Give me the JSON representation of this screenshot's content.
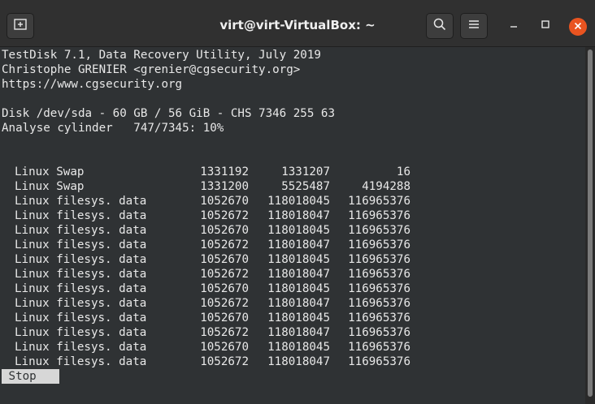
{
  "window": {
    "title": "virt@virt-VirtualBox: ~",
    "icons": {
      "new_tab": "new-tab-icon",
      "search": "search-icon",
      "menu": "hamburger-menu-icon",
      "minimize": "minimize-icon",
      "maximize": "maximize-icon",
      "close": "close-icon"
    },
    "colors": {
      "close_accent": "#e95420",
      "terminal_bg": "#2f3234",
      "terminal_fg": "#e8e8e8"
    }
  },
  "terminal": {
    "header_lines": [
      "TestDisk 7.1, Data Recovery Utility, July 2019",
      "Christophe GRENIER <grenier@cgsecurity.org>",
      "https://www.cgsecurity.org",
      "",
      "Disk /dev/sda - 60 GB / 56 GiB - CHS 7346 255 63",
      "Analyse cylinder   747/7345: 10%"
    ],
    "partitions": [
      {
        "type": "Linux Swap",
        "start": "1331192",
        "end": "1331207",
        "size": "16"
      },
      {
        "type": "Linux Swap",
        "start": "1331200",
        "end": "5525487",
        "size": "4194288"
      },
      {
        "type": "Linux filesys. data",
        "start": "1052670",
        "end": "118018045",
        "size": "116965376"
      },
      {
        "type": "Linux filesys. data",
        "start": "1052672",
        "end": "118018047",
        "size": "116965376"
      },
      {
        "type": "Linux filesys. data",
        "start": "1052670",
        "end": "118018045",
        "size": "116965376"
      },
      {
        "type": "Linux filesys. data",
        "start": "1052672",
        "end": "118018047",
        "size": "116965376"
      },
      {
        "type": "Linux filesys. data",
        "start": "1052670",
        "end": "118018045",
        "size": "116965376"
      },
      {
        "type": "Linux filesys. data",
        "start": "1052672",
        "end": "118018047",
        "size": "116965376"
      },
      {
        "type": "Linux filesys. data",
        "start": "1052670",
        "end": "118018045",
        "size": "116965376"
      },
      {
        "type": "Linux filesys. data",
        "start": "1052672",
        "end": "118018047",
        "size": "116965376"
      },
      {
        "type": "Linux filesys. data",
        "start": "1052670",
        "end": "118018045",
        "size": "116965376"
      },
      {
        "type": "Linux filesys. data",
        "start": "1052672",
        "end": "118018047",
        "size": "116965376"
      },
      {
        "type": "Linux filesys. data",
        "start": "1052670",
        "end": "118018045",
        "size": "116965376"
      },
      {
        "type": "Linux filesys. data",
        "start": "1052672",
        "end": "118018047",
        "size": "116965376"
      }
    ],
    "stop_label": " Stop "
  }
}
